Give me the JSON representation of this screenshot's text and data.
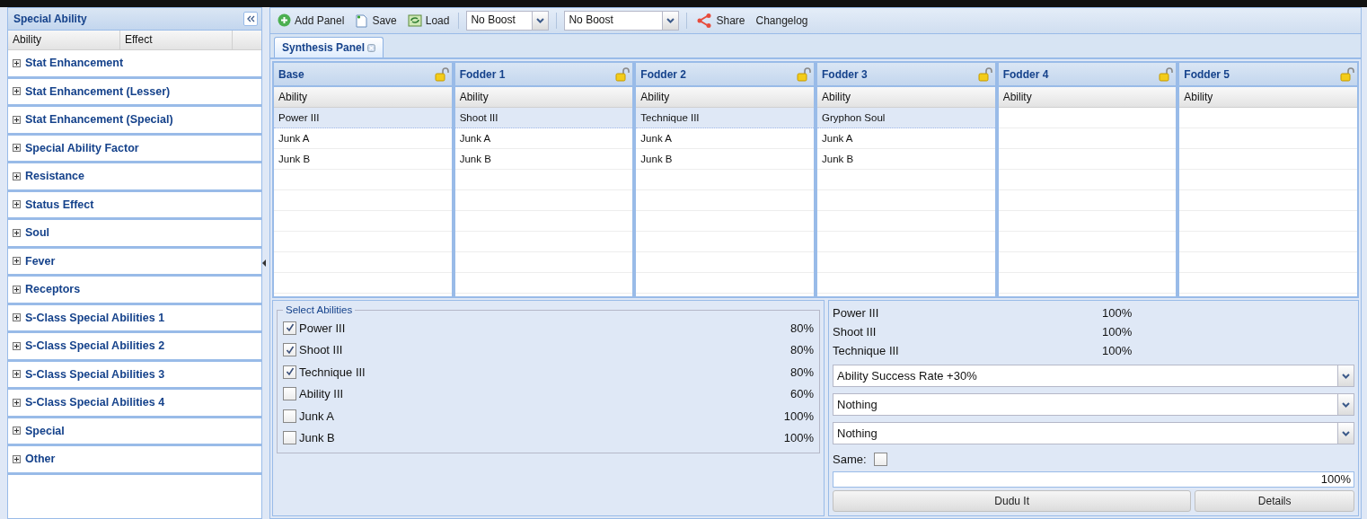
{
  "sidebar": {
    "title": "Special Ability",
    "columns": [
      "Ability",
      "Effect"
    ],
    "groups": [
      {
        "label": "Stat Enhancement",
        "expanded": false
      },
      {
        "label": "Stat Enhancement (Lesser)",
        "expanded": false
      },
      {
        "label": "Stat Enhancement (Special)",
        "expanded": false
      },
      {
        "label": "Special Ability Factor",
        "expanded": false
      },
      {
        "label": "Resistance",
        "expanded": false
      },
      {
        "label": "Status Effect",
        "expanded": false
      },
      {
        "label": "Soul",
        "expanded": false
      },
      {
        "label": "Fever",
        "expanded": false
      },
      {
        "label": "Receptors",
        "expanded": false
      },
      {
        "label": "S-Class Special Abilities 1",
        "expanded": false
      },
      {
        "label": "S-Class Special Abilities 2",
        "expanded": false
      },
      {
        "label": "S-Class Special Abilities 3",
        "expanded": false
      },
      {
        "label": "S-Class Special Abilities 4",
        "expanded": false
      },
      {
        "label": "Special",
        "expanded": false
      },
      {
        "label": "Other",
        "expanded": false
      }
    ]
  },
  "toolbar": {
    "buttons": [
      {
        "kind": "add",
        "label": "Add Panel"
      },
      {
        "kind": "save",
        "label": "Save"
      },
      {
        "kind": "load",
        "label": "Load"
      }
    ],
    "boosts": [
      {
        "value": "No Boost"
      },
      {
        "value": "No Boost"
      }
    ],
    "links": [
      {
        "kind": "share",
        "label": "Share"
      },
      {
        "kind": "text",
        "label": "Changelog"
      }
    ]
  },
  "tabs": [
    {
      "label": "Synthesis Panel",
      "selected": true
    }
  ],
  "grids": [
    {
      "title": "Base",
      "column": "Ability",
      "rows": [
        {
          "text": "Power III",
          "selected": true
        },
        {
          "text": "Junk A",
          "selected": false
        },
        {
          "text": "Junk B",
          "selected": false
        }
      ]
    },
    {
      "title": "Fodder 1",
      "column": "Ability",
      "rows": [
        {
          "text": "Shoot III",
          "selected": true
        },
        {
          "text": "Junk A",
          "selected": false
        },
        {
          "text": "Junk B",
          "selected": false
        }
      ]
    },
    {
      "title": "Fodder 2",
      "column": "Ability",
      "rows": [
        {
          "text": "Technique III",
          "selected": true
        },
        {
          "text": "Junk A",
          "selected": false
        },
        {
          "text": "Junk B",
          "selected": false
        }
      ]
    },
    {
      "title": "Fodder 3",
      "column": "Ability",
      "rows": [
        {
          "text": "Gryphon Soul",
          "selected": true
        },
        {
          "text": "Junk A",
          "selected": false
        },
        {
          "text": "Junk B",
          "selected": false
        }
      ]
    },
    {
      "title": "Fodder 4",
      "column": "Ability"
    },
    {
      "title": "Fodder 5",
      "column": "Ability"
    }
  ],
  "select_abilities": {
    "legend": "Select Abilities",
    "items": [
      {
        "label": "Power III",
        "rate": "80%",
        "checked": true
      },
      {
        "label": "Shoot III",
        "rate": "80%",
        "checked": true
      },
      {
        "label": "Technique III",
        "rate": "80%",
        "checked": true
      },
      {
        "label": "Ability III",
        "rate": "60%",
        "checked": false
      },
      {
        "label": "Junk A",
        "rate": "100%",
        "checked": false
      },
      {
        "label": "Junk B",
        "rate": "100%",
        "checked": false
      }
    ]
  },
  "results": {
    "items": [
      {
        "label": "Power III",
        "rate": "100%"
      },
      {
        "label": "Shoot III",
        "rate": "100%"
      },
      {
        "label": "Technique III",
        "rate": "100%"
      }
    ],
    "boost_selects": [
      {
        "value": "Ability Success Rate +30%"
      },
      {
        "value": "Nothing"
      },
      {
        "value": "Nothing"
      }
    ],
    "same": {
      "label": "Same:",
      "checked": false
    },
    "total": "100%",
    "buttons": [
      "Dudu It",
      "Details"
    ]
  }
}
